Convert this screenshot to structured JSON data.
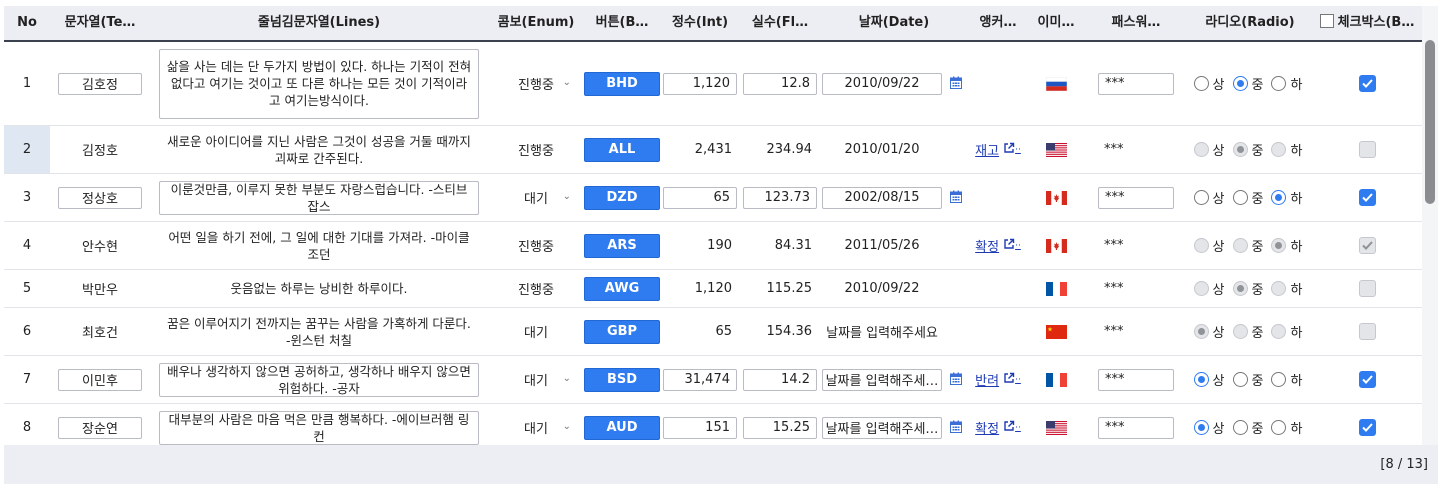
{
  "columns": [
    "No",
    "문자열(Te…",
    "줄넘김문자열(Lines)",
    "콤보(Enum)",
    "버튼(B…",
    "정수(Int)",
    "실수(Fl…",
    "날짜(Date)",
    "앵커…",
    "이미…",
    "패스워…",
    "라디오(Radio)",
    "체크박스(B…"
  ],
  "radio_labels": [
    "상",
    "중",
    "하"
  ],
  "pager": "[8 / 13]",
  "rows": [
    {
      "no": "1",
      "text": "김호정",
      "lines": "삶을 사는 데는 단 두가지 방법이 있다. 하나는 기적이 전혀 없다고 여기는 것이고 또 다른 하나는 모든 것이 기적이라고 여기는방식이다.",
      "combo": "진행중",
      "button": "BHD",
      "int": "1,120",
      "float": "12.8",
      "date": "2010/09/22",
      "anchor": "",
      "flag": "ru",
      "password": "***",
      "radio": 1,
      "checked": true,
      "editable": true
    },
    {
      "no": "2",
      "text": "김정호",
      "lines": "새로운 아이디어를 지닌 사람은 그것이 성공을 거둘 때까지 괴짜로 간주된다.",
      "combo": "진행중",
      "button": "ALL",
      "int": "2,431",
      "float": "234.94",
      "date": "2010/01/20",
      "anchor": "재고",
      "flag": "us",
      "password": "***",
      "radio": 1,
      "checked": false,
      "editable": false
    },
    {
      "no": "3",
      "text": "정상호",
      "lines": "이룬것만큼, 이루지 못한 부분도 자랑스럽습니다. -스티브 잡스",
      "combo": "대기",
      "button": "DZD",
      "int": "65",
      "float": "123.73",
      "date": "2002/08/15",
      "anchor": "",
      "flag": "ca",
      "password": "***",
      "radio": 2,
      "checked": true,
      "editable": true
    },
    {
      "no": "4",
      "text": "안수현",
      "lines": "어떤 일을 하기 전에, 그 일에 대한 기대를 가져라. -마이클 조던",
      "combo": "진행중",
      "button": "ARS",
      "int": "190",
      "float": "84.31",
      "date": "2011/05/26",
      "anchor": "확정",
      "flag": "ca",
      "password": "***",
      "radio": 2,
      "checked": true,
      "editable": false
    },
    {
      "no": "5",
      "text": "박만우",
      "lines": "웃음없는 하루는 낭비한 하루이다.",
      "combo": "진행중",
      "button": "AWG",
      "int": "1,120",
      "float": "115.25",
      "date": "2010/09/22",
      "anchor": "",
      "flag": "fr",
      "password": "***",
      "radio": 1,
      "checked": false,
      "editable": false
    },
    {
      "no": "6",
      "text": "최호건",
      "lines": "꿈은 이루어지기 전까지는 꿈꾸는 사람을 가혹하게 다룬다. -윈스턴 처칠",
      "combo": "대기",
      "button": "GBP",
      "int": "65",
      "float": "154.36",
      "date": "날짜를 입력해주세요",
      "anchor": "",
      "flag": "cn",
      "password": "***",
      "radio": 0,
      "checked": false,
      "editable": false
    },
    {
      "no": "7",
      "text": "이민후",
      "lines": "배우나 생각하지 않으면 공허하고, 생각하나 배우지 않으면 위험하다. -공자",
      "combo": "대기",
      "button": "BSD",
      "int": "31,474",
      "float": "14.2",
      "date": "날짜를 입력해주세…",
      "anchor": "반려",
      "flag": "fr",
      "password": "***",
      "radio": 0,
      "checked": true,
      "editable": true
    },
    {
      "no": "8",
      "text": "장순연",
      "lines": "대부분의 사람은 마음 먹은 만큼 행복하다. -에이브러햄 링컨",
      "combo": "대기",
      "button": "AUD",
      "int": "151",
      "float": "15.25",
      "date": "날짜를 입력해주세…",
      "anchor": "확정",
      "flag": "us",
      "password": "***",
      "radio": 0,
      "checked": true,
      "editable": true
    }
  ]
}
